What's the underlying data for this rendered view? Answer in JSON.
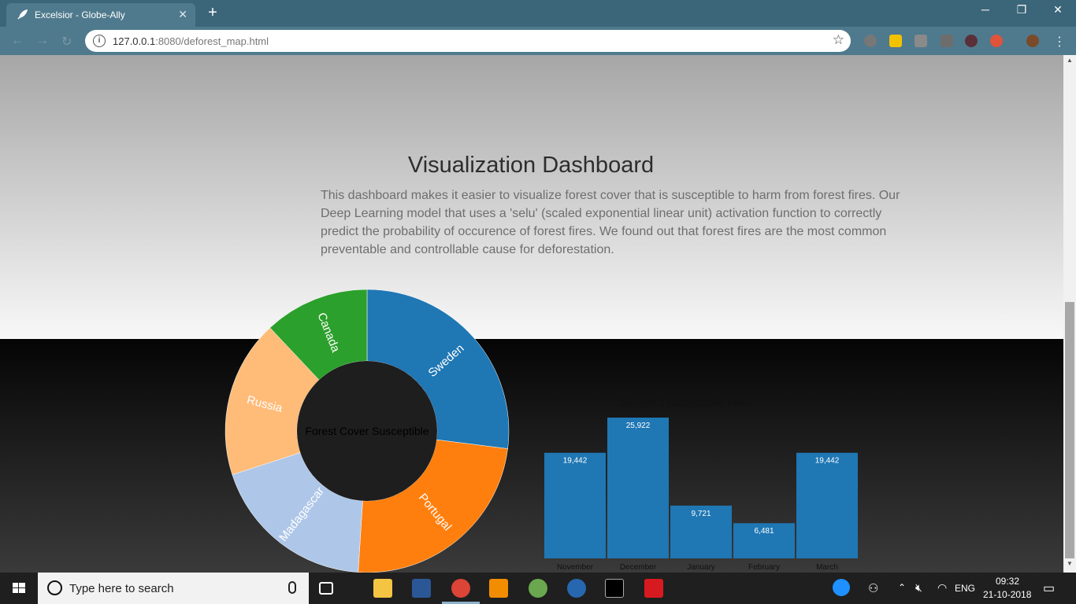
{
  "browser": {
    "tab_title": "Excelsior - Globe-Ally",
    "url_host": "127.0.0.1",
    "url_rest": ":8080/deforest_map.html"
  },
  "page": {
    "title": "Visualization Dashboard",
    "description": "This dashboard makes it easier to visualize forest cover that is susceptible to harm from forest fires. Our Deep Learning model that uses a 'selu' (scaled exponential linear unit) activation function to correctly predict the probability of occurence of forest fires. We found out that forest fires are the most common preventable and controllable cause for deforestation."
  },
  "chart_data": [
    {
      "type": "pie",
      "donut": true,
      "center_label": "Forest Cover Susceptible",
      "categories": [
        "Sweden",
        "Portugal",
        "Madagascar",
        "Russia",
        "Canada"
      ],
      "values": [
        27,
        24,
        19,
        18,
        12
      ],
      "colors": [
        "#1f77b4",
        "#ff7f0e",
        "#aec7e8",
        "#ffbb78",
        "#2ca02c"
      ]
    },
    {
      "type": "bar",
      "title": "Sweden's susceptibility index",
      "categories": [
        "November",
        "December",
        "January",
        "February",
        "March"
      ],
      "values": [
        19442,
        25922,
        9721,
        6481,
        19442
      ],
      "value_labels": [
        "19,442",
        "25,922",
        "9,721",
        "6,481",
        "19,442"
      ],
      "ylim": [
        0,
        25922
      ],
      "color": "#1f77b4"
    }
  ],
  "taskbar": {
    "search_placeholder": "Type here to search",
    "language": "ENG",
    "time": "09:32",
    "date": "21-10-2018"
  }
}
